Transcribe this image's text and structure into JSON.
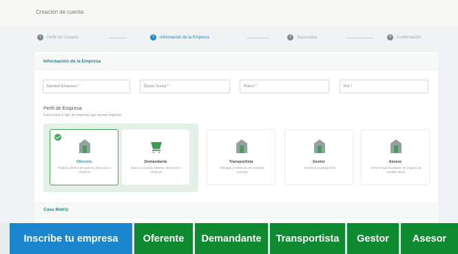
{
  "page_title": "Creación de cuenta",
  "steps": [
    {
      "number": "1",
      "label": "Perfil del Usuario",
      "active": false
    },
    {
      "number": "2",
      "label": "Información de la Empresa",
      "active": true
    },
    {
      "number": "3",
      "label": "Sucursales",
      "active": false
    },
    {
      "number": "4",
      "label": "Confirmación",
      "active": false
    }
  ],
  "section_empresa": "Información de la Empresa",
  "fields": {
    "nombre": "Nombre Empresa *",
    "razon_social": "Razón Social *",
    "rubro": "Rubro *",
    "rut": "Rut *"
  },
  "perfil": {
    "title": "Perfil de Empresa",
    "subtitle": "Selecciona el tipo de empresa que desear registrar:"
  },
  "options": [
    {
      "name": "Oferente",
      "desc": "Publica ofertas de materia, desechos o residuos",
      "selected": true
    },
    {
      "name": "Demandante",
      "desc": "Busca y solicita materia, desechos o residuos",
      "selected": false
    },
    {
      "name": "Transportista",
      "desc": "Traslado y retención de material residual",
      "selected": false
    },
    {
      "name": "Gestor",
      "desc": "Gestiona material ESS",
      "selected": false
    },
    {
      "name": "Asesor",
      "desc": "Genera oportunidades de negocio al resaltar datos",
      "selected": false
    }
  ],
  "section_casa": "Casa Matriz",
  "buttons": {
    "inscribe": "Inscribe tu empresa",
    "oferente": "Oferente",
    "demandante": "Demandante",
    "transportista": "Transportista",
    "gestor": "Gestor",
    "asesor": "Asesor"
  },
  "colors": {
    "primary_blue": "#1a86cd",
    "primary_green": "#0e8b30",
    "selected_border": "#48a85a",
    "selected_bg": "#e3f1e6"
  }
}
